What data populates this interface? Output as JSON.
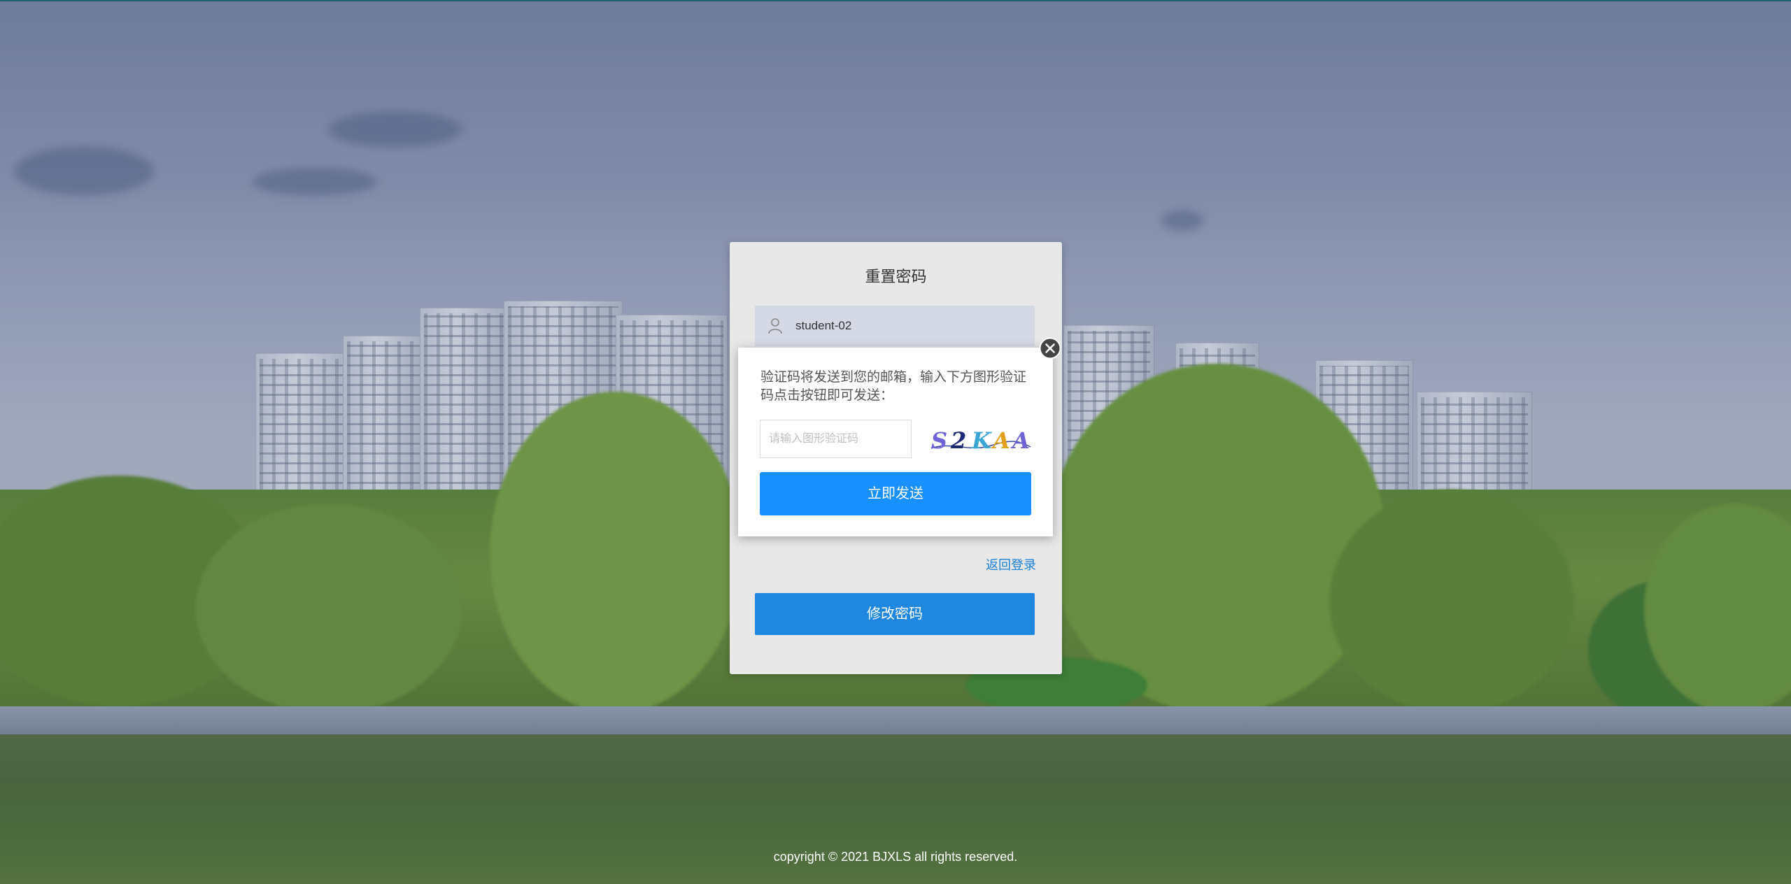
{
  "card": {
    "title": "重置密码",
    "username": "student-02",
    "back_link": "返回登录",
    "submit_label": "修改密码"
  },
  "popup": {
    "message": "验证码将发送到您的邮箱，输入下方图形验证码点击按钮即可发送：",
    "captcha_placeholder": "请输入图形验证码",
    "captcha_value": "",
    "captcha_text": "S2KAA",
    "send_label": "立即发送"
  },
  "footer": {
    "copyright": "copyright © 2021 BJXLS all rights reserved."
  },
  "colors": {
    "primary": "#1890ff",
    "submit": "#1f87e0",
    "link": "#1b7fd8"
  },
  "icons": {
    "user": "user-icon",
    "close": "close-icon"
  }
}
